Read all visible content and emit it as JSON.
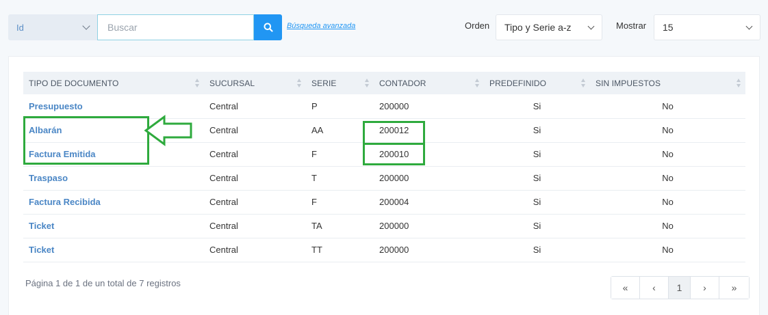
{
  "toolbar": {
    "field_select": "Id",
    "search_placeholder": "Buscar",
    "advanced_link": "Búsqueda avanzada",
    "order_label": "Orden",
    "order_value": "Tipo y Serie a-z",
    "show_label": "Mostrar",
    "show_value": "15"
  },
  "table": {
    "headers": [
      "TIPO DE DOCUMENTO",
      "SUCURSAL",
      "SERIE",
      "CONTADOR",
      "PREDEFINIDO",
      "SIN IMPUESTOS"
    ],
    "rows": [
      [
        "Presupuesto",
        "Central",
        "P",
        "200000",
        "Si",
        "No"
      ],
      [
        "Albarán",
        "Central",
        "AA",
        "200012",
        "Si",
        "No"
      ],
      [
        "Factura Emitida",
        "Central",
        "F",
        "200010",
        "Si",
        "No"
      ],
      [
        "Traspaso",
        "Central",
        "T",
        "200000",
        "Si",
        "No"
      ],
      [
        "Factura Recibida",
        "Central",
        "F",
        "200004",
        "Si",
        "No"
      ],
      [
        "Ticket",
        "Central",
        "TA",
        "200000",
        "Si",
        "No"
      ],
      [
        "Ticket",
        "Central",
        "TT",
        "200000",
        "Si",
        "No"
      ]
    ]
  },
  "footer": {
    "summary": "Página 1 de 1 de un total de 7 registros",
    "pager": {
      "first": "«",
      "prev": "‹",
      "current": "1",
      "next": "›",
      "last": "»"
    }
  },
  "colors": {
    "accent": "#2196f3",
    "link": "#4a86c5",
    "annotation": "#2eaa3d"
  }
}
